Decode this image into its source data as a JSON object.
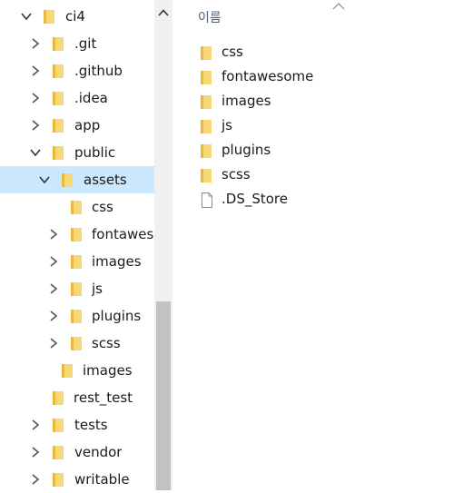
{
  "tree": {
    "items": [
      {
        "label": "ci4",
        "expanded": true
      },
      {
        "label": ".git"
      },
      {
        "label": ".github"
      },
      {
        "label": ".idea"
      },
      {
        "label": "app"
      },
      {
        "label": "public",
        "expanded": true
      },
      {
        "label": "assets",
        "expanded": true,
        "selected": true
      },
      {
        "label": "css"
      },
      {
        "label": "fontawesome"
      },
      {
        "label": "images"
      },
      {
        "label": "js"
      },
      {
        "label": "plugins"
      },
      {
        "label": "scss"
      },
      {
        "label": "images"
      },
      {
        "label": "rest_test"
      },
      {
        "label": "tests"
      },
      {
        "label": "vendor"
      },
      {
        "label": "writable"
      }
    ]
  },
  "content": {
    "column_header": "이름",
    "items": [
      {
        "label": "css",
        "type": "folder"
      },
      {
        "label": "fontawesome",
        "type": "folder"
      },
      {
        "label": "images",
        "type": "folder"
      },
      {
        "label": "js",
        "type": "folder"
      },
      {
        "label": "plugins",
        "type": "folder"
      },
      {
        "label": "scss",
        "type": "folder"
      },
      {
        "label": ".DS_Store",
        "type": "file"
      }
    ]
  },
  "colors": {
    "selection": "#cce8ff",
    "folder": "#f8d775",
    "folder_dark": "#e8b93c",
    "scrollbar_track": "#f0f0f0",
    "scrollbar_thumb": "#c2c2c2"
  }
}
